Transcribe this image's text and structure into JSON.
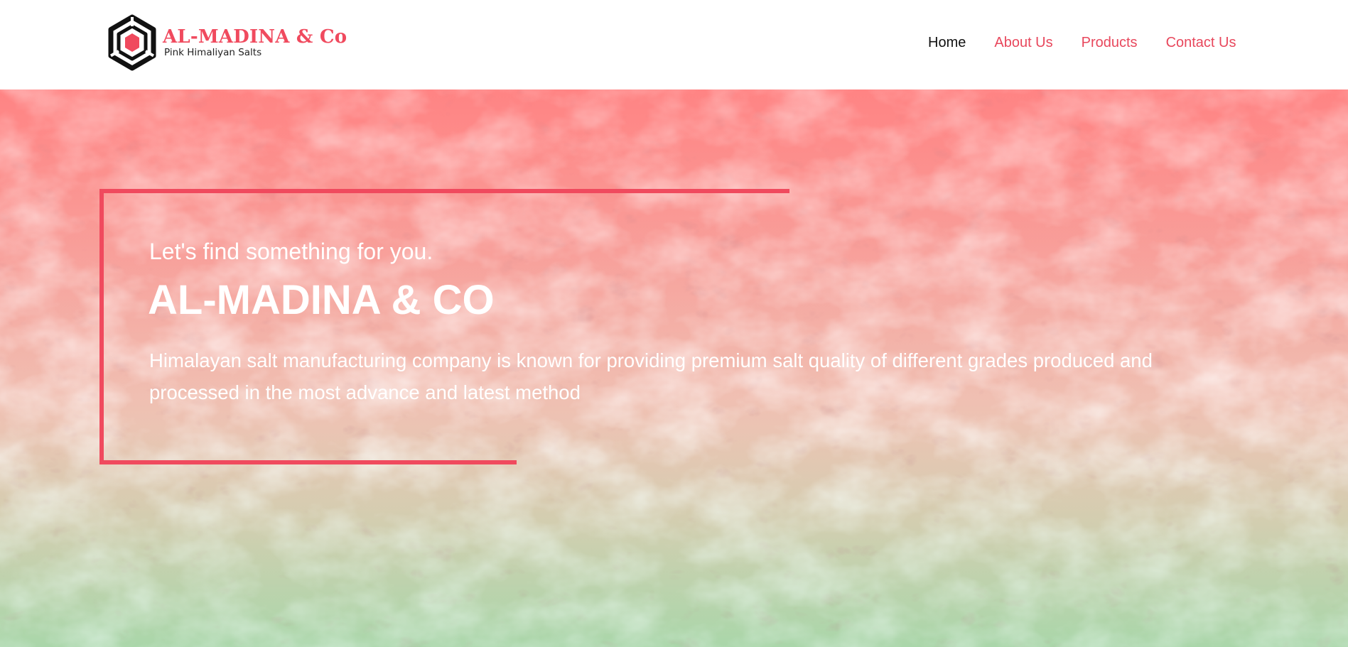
{
  "colors": {
    "accent": "#f04a5e",
    "nav_link": "#e8475c",
    "nav_active": "#111111",
    "text_on_hero": "#ffffff"
  },
  "brand": {
    "name": "AL-MADINA & Co",
    "tagline": "Pink Himaliyan Salts",
    "logo_icon": "hexagon-logo-icon"
  },
  "nav": {
    "items": [
      {
        "label": "Home",
        "active": true
      },
      {
        "label": "About Us",
        "active": false
      },
      {
        "label": "Products",
        "active": false
      },
      {
        "label": "Contact Us",
        "active": false
      }
    ]
  },
  "hero": {
    "kicker": "Let's find something for you.",
    "title": "AL-MADINA & CO",
    "description": "Himalayan salt manufacturing company is known for providing premium salt quality of different grades produced and processed in the most advance and latest method",
    "background_image": "pink-himalayan-salt-image"
  }
}
